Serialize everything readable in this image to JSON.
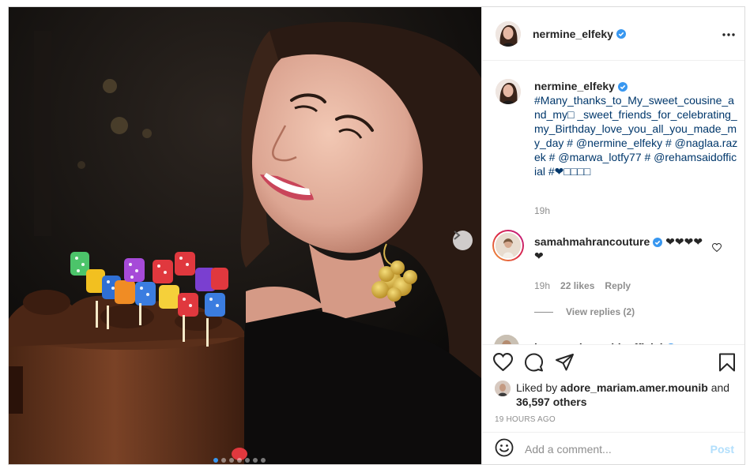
{
  "post": {
    "username": "nermine_elfeky",
    "menu_icon": "more-horizontal-icon"
  },
  "caption": {
    "username": "nermine_elfeky",
    "text": "#Many_thanks_to_My_sweet_cousine_and_my□ _sweet_friends_for_celebrating_my_Birthday_love_you_all_you_made_my_day # @nermine_elfeky # @naglaa.razek # @marwa_lotfy77 # @rehamsaidofficial #❤□□□□",
    "time": "19h"
  },
  "comments": [
    {
      "username": "samahmahrancouture",
      "text": "❤❤❤❤ ❤",
      "time": "19h",
      "likes": "22 likes",
      "reply_label": "Reply",
      "view_replies": "View replies (2)"
    },
    {
      "username": "kareemabouzeid_official",
      "text": "□"
    }
  ],
  "likes": {
    "prefix": "Liked by",
    "user": "adore_mariam.amer.mounib",
    "joiner": "and",
    "count": "36,597 others"
  },
  "timestamp": "19 HOURS AGO",
  "add_comment": {
    "placeholder": "Add a comment...",
    "post_label": "Post"
  },
  "carousel": {
    "slide_count": 7,
    "active_index": 0
  },
  "colors": {
    "verified": "#3897f0",
    "link": "#00376b",
    "muted": "#8e8e8e",
    "post_button_disabled": "#b2dffc"
  }
}
